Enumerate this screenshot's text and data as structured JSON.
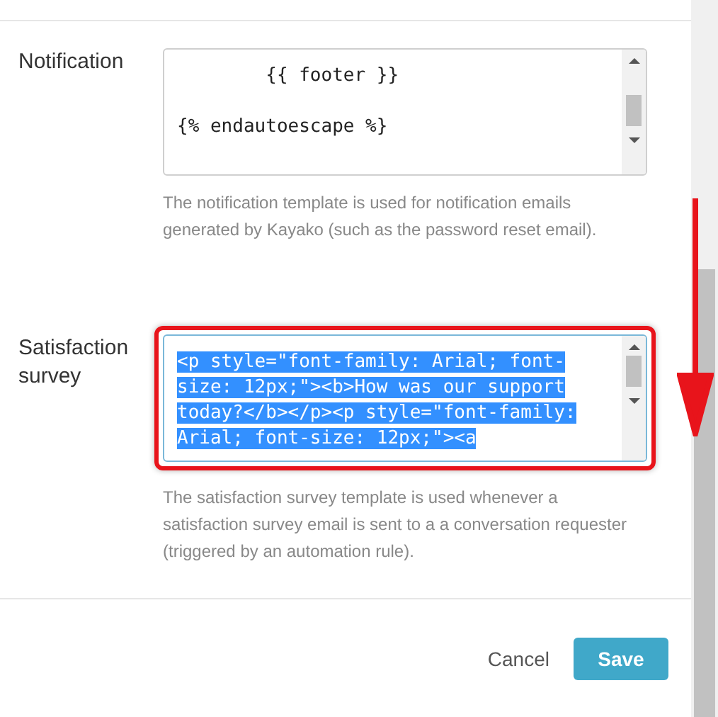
{
  "sections": [
    {
      "label": "Notification",
      "line_groups": [
        [
          "        {{ footer }}"
        ],
        [
          "{% endautoescape %}"
        ]
      ],
      "selected": false,
      "highlighted": false,
      "help": "The notification template is used for notification emails generated by Kayako (such as the password reset email)."
    },
    {
      "label": "Satisfaction survey",
      "line_groups": [
        [
          "<p style=\"font-family: Arial; font-",
          "size: 12px;\"><b>How was our support",
          "today?</b></p><p style=\"font-family:",
          "Arial; font-size: 12px;\"><a"
        ]
      ],
      "selected": true,
      "highlighted": true,
      "help": "The satisfaction survey template is used whenever a satisfaction survey email is sent to a a conversation requester (triggered by an automation rule)."
    }
  ],
  "buttons": {
    "cancel": "Cancel",
    "save": "Save"
  }
}
